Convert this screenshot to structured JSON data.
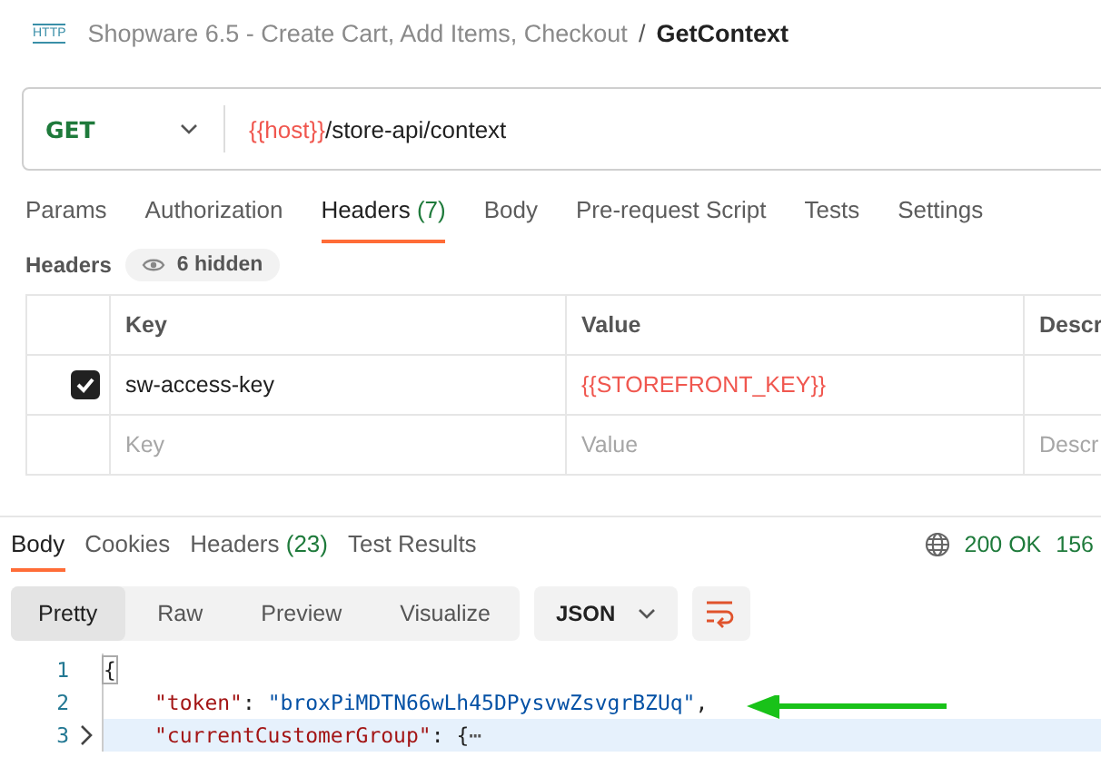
{
  "breadcrumb": {
    "type_badge": "HTTP",
    "collection": "Shopware 6.5 - Create Cart, Add Items, Checkout",
    "separator": "/",
    "request": "GetContext"
  },
  "request": {
    "method": "GET",
    "url": [
      {
        "text": "{{host}}",
        "kind": "variable"
      },
      {
        "text": "/store-api/context",
        "kind": "plain"
      }
    ]
  },
  "request_tabs": [
    {
      "label": "Params",
      "selected": false
    },
    {
      "label": "Authorization",
      "selected": false
    },
    {
      "label": "Headers",
      "count": "(7)",
      "selected": true
    },
    {
      "label": "Body",
      "selected": false
    },
    {
      "label": "Pre-request Script",
      "selected": false
    },
    {
      "label": "Tests",
      "selected": false
    },
    {
      "label": "Settings",
      "selected": false
    }
  ],
  "headers_section": {
    "title": "Headers",
    "hidden_badge": "6 hidden"
  },
  "table": {
    "columns": [
      "Key",
      "Value",
      "Descr"
    ],
    "rows": [
      {
        "checked": true,
        "key": "sw-access-key",
        "value": [
          {
            "text": "{{STOREFRONT_KEY}}",
            "kind": "variable"
          }
        ]
      }
    ],
    "placeholders": {
      "key": "Key",
      "value": "Value",
      "description": "Descr"
    }
  },
  "response_tabs": [
    {
      "label": "Body",
      "selected": true
    },
    {
      "label": "Cookies",
      "selected": false
    },
    {
      "label": "Headers",
      "count": "(23)",
      "selected": false
    },
    {
      "label": "Test Results",
      "selected": false
    }
  ],
  "status": {
    "code": "200 OK",
    "time": "156"
  },
  "view_modes": [
    {
      "label": "Pretty",
      "selected": true
    },
    {
      "label": "Raw",
      "selected": false
    },
    {
      "label": "Preview",
      "selected": false
    },
    {
      "label": "Visualize",
      "selected": false
    }
  ],
  "format": "JSON",
  "code_lines": [
    {
      "number": "1",
      "highlighted": false,
      "collapsed": false,
      "tokens": [
        {
          "text": "{",
          "kind": "brace_match"
        }
      ],
      "children": [
        {
          "number": "2",
          "highlighted": false,
          "collapsed": false,
          "tokens": [
            {
              "text": "\"token\"",
              "kind": "key"
            },
            {
              "text": ": ",
              "kind": "punct"
            },
            {
              "text": "\"broxPiMDTN66wLh45DPysvwZsvgrBZUq\"",
              "kind": "string"
            },
            {
              "text": ",",
              "kind": "punct"
            }
          ]
        },
        {
          "number": "3",
          "highlighted": true,
          "collapsed": true,
          "tokens": [
            {
              "text": "\"currentCustomerGroup\"",
              "kind": "key"
            },
            {
              "text": ": ",
              "kind": "punct"
            },
            {
              "text": "{",
              "kind": "punct"
            },
            {
              "text": "⋯",
              "kind": "fold"
            }
          ]
        }
      ]
    }
  ]
}
